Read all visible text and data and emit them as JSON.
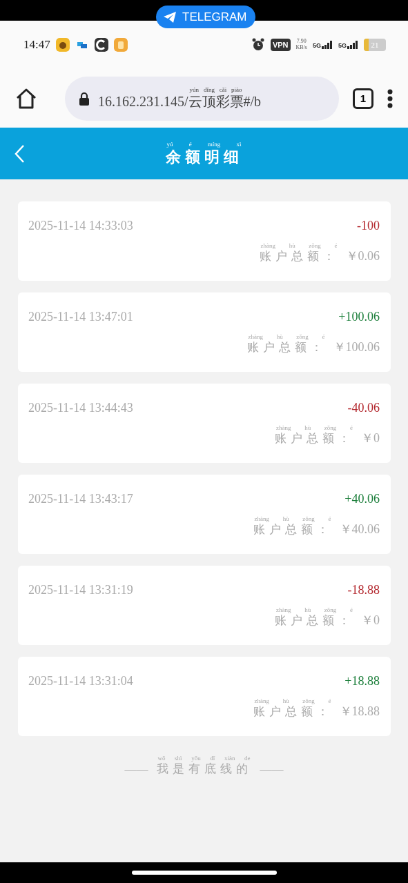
{
  "overlay": {
    "label": "TELEGRAM"
  },
  "status_bar": {
    "time": "14:47",
    "vpn": "VPN",
    "speed": "7.90",
    "speed_unit": "KB/s",
    "sim1": "5G",
    "sim2": "5G",
    "battery": "21"
  },
  "browser": {
    "url_prefix": "16.162.231.145/",
    "url_pinyin": "yún dǐng cǎi piào",
    "url_hanzi": "云顶彩票",
    "url_suffix": "#/b",
    "tab_count": "1"
  },
  "header": {
    "title_pinyin": "yú é míng xì",
    "title": "余额明细"
  },
  "records": [
    {
      "time": "2025-11-14 14:33:03",
      "amount": "-100",
      "kind": "debit",
      "label_pinyin": "zhàng hù zǒng é",
      "label": "账户总额：",
      "balance": "￥0.06"
    },
    {
      "time": "2025-11-14 13:47:01",
      "amount": "+100.06",
      "kind": "credit",
      "label_pinyin": "zhàng hù zǒng é",
      "label": "账户总额：",
      "balance": "￥100.06"
    },
    {
      "time": "2025-11-14 13:44:43",
      "amount": "-40.06",
      "kind": "debit",
      "label_pinyin": "zhàng hù zǒng é",
      "label": "账户总额：",
      "balance": "￥0"
    },
    {
      "time": "2025-11-14 13:43:17",
      "amount": "+40.06",
      "kind": "credit",
      "label_pinyin": "zhàng hù zǒng é",
      "label": "账户总额：",
      "balance": "￥40.06"
    },
    {
      "time": "2025-11-14 13:31:19",
      "amount": "-18.88",
      "kind": "debit",
      "label_pinyin": "zhàng hù zǒng é",
      "label": "账户总额：",
      "balance": "￥0"
    },
    {
      "time": "2025-11-14 13:31:04",
      "amount": "+18.88",
      "kind": "credit",
      "label_pinyin": "zhàng hù zǒng é",
      "label": "账户总额：",
      "balance": "￥18.88"
    }
  ],
  "footer": {
    "dash_left": "——",
    "pinyin": "wǒ shì yǒu dǐ xiàn de",
    "text": "我是有底线的",
    "dash_right": "——"
  }
}
